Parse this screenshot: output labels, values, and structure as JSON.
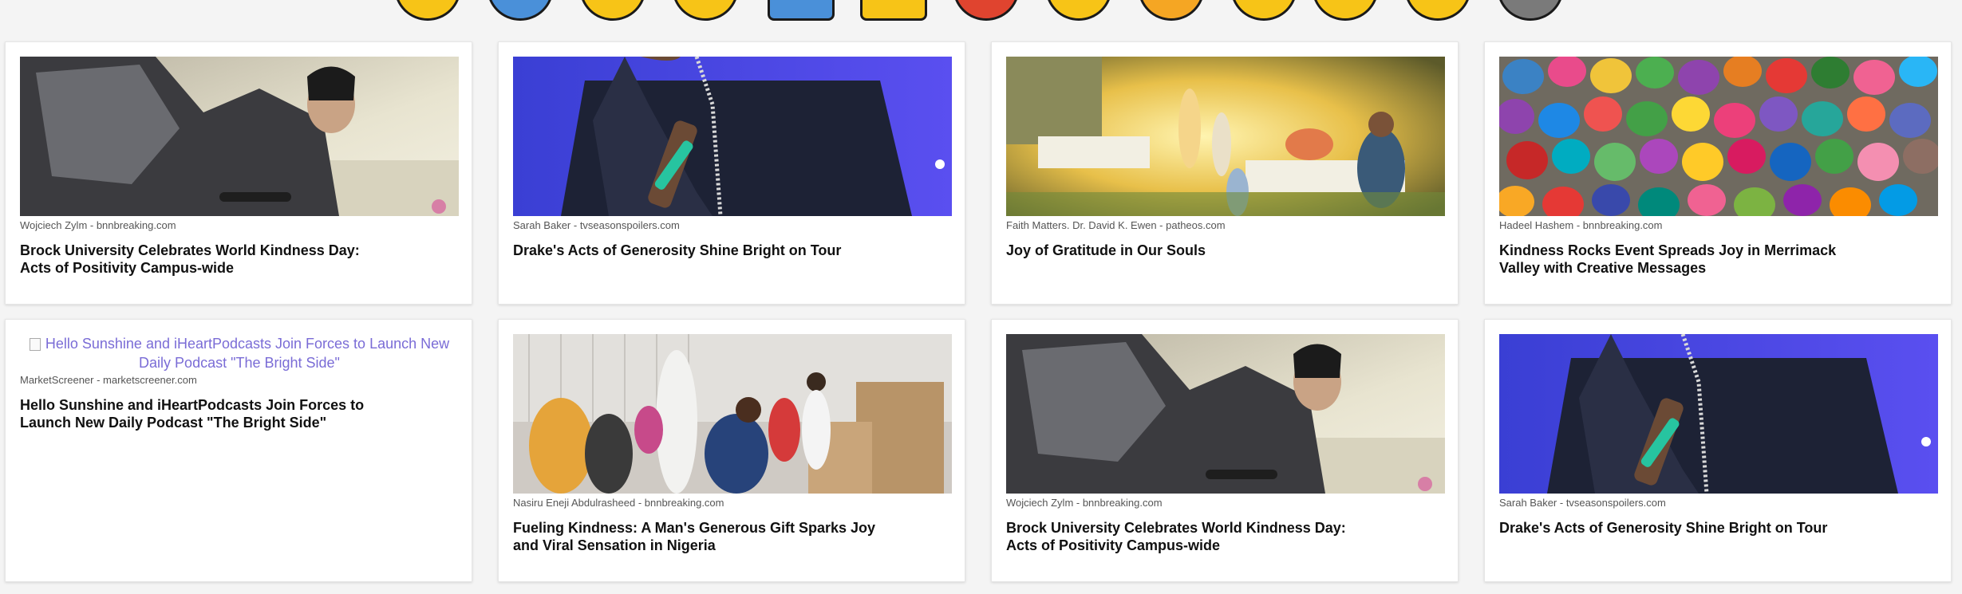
{
  "emoji_strip": {
    "icons": [
      {
        "name": "laughing-face-icon",
        "color": "#f7c417"
      },
      {
        "name": "cold-face-icon",
        "color": "#4a90d9"
      },
      {
        "name": "neutral-face-icon",
        "color": "#f7c417"
      },
      {
        "name": "surprised-face-icon",
        "color": "#f7c417"
      },
      {
        "name": "cross-mark-icon",
        "color": "#4a90d9"
      },
      {
        "name": "raised-hands-icon",
        "color": "#f7c417"
      },
      {
        "name": "angry-face-icon",
        "color": "#e0442f"
      },
      {
        "name": "smiling-face-icon",
        "color": "#f7c417"
      },
      {
        "name": "fire-face-icon",
        "color": "#f5a623"
      },
      {
        "name": "cloud-face-icon",
        "color": "#f7c417"
      },
      {
        "name": "bell-face-icon",
        "color": "#f7c417"
      },
      {
        "name": "thinking-face-icon",
        "color": "#f7c417"
      },
      {
        "name": "robot-face-icon",
        "color": "#7a7a7a"
      }
    ]
  },
  "articles": [
    {
      "image": "student-kneeling",
      "byline": "Wojciech Zylm - bnnbreaking.com",
      "title": "Brock University Celebrates World Kindness Day: Acts of Positivity Campus-wide"
    },
    {
      "image": "performer-microphone",
      "byline": "Sarah Baker - tvseasonspoilers.com",
      "title": "Drake's Acts of Generosity Shine Bright on Tour"
    },
    {
      "image": "family-garden-feast",
      "byline": "Faith Matters. Dr. David K. Ewen - patheos.com",
      "title": "Joy of Gratitude in Our Souls"
    },
    {
      "image": "painted-heart-rocks",
      "byline": "Hadeel Hashem - bnnbreaking.com",
      "title": "Kindness Rocks Event Spreads Joy in Merrimack Valley with Creative Messages"
    },
    {
      "image": "broken",
      "alt": "Hello Sunshine and iHeartPodcasts Join Forces to Launch New Daily Podcast \"The Bright Side\"",
      "byline": "MarketScreener - marketscreener.com",
      "title": "Hello Sunshine and iHeartPodcasts Join Forces to Launch New Daily Podcast \"The Bright Side\""
    },
    {
      "image": "wheelchair-donation",
      "byline": "Nasiru Eneji Abdulrasheed - bnnbreaking.com",
      "title": "Fueling Kindness: A Man's Generous Gift Sparks Joy and Viral Sensation in Nigeria"
    },
    {
      "image": "student-kneeling",
      "byline": "Wojciech Zylm - bnnbreaking.com",
      "title": "Brock University Celebrates World Kindness Day: Acts of Positivity Campus-wide"
    },
    {
      "image": "performer-microphone",
      "byline": "Sarah Baker - tvseasonspoilers.com",
      "title": "Drake's Acts of Generosity Shine Bright on Tour"
    }
  ]
}
